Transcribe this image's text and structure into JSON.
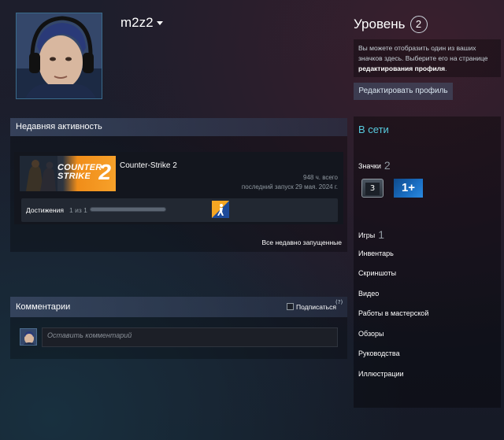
{
  "profile": {
    "username": "m2z2"
  },
  "level": {
    "title": "Уровень",
    "value": "2",
    "description_part1": "Вы можете отобразить один из ваших значков здесь. Выберите его на странице ",
    "description_link": "редактирования профиля",
    "description_end": ".",
    "edit_button": "Редактировать профиль"
  },
  "recent_activity": {
    "title": "Недавняя активность",
    "game": {
      "name": "Counter-Strike 2",
      "cover_line1": "COUNTER",
      "cover_line2": "STRIKE",
      "cover_number": "2",
      "hours": "948 ч. всего",
      "last_played": "последний запуск 29 мая. 2024 г."
    },
    "achievements": {
      "label": "Достижения",
      "count": "1 из 1",
      "progress_fraction": 1.0
    },
    "all_recent": "Все недавно запущенные"
  },
  "comments": {
    "title": "Комментарии",
    "subscribe": "Подписаться",
    "help": "(?)",
    "placeholder": "Оставить комментарий"
  },
  "sidebar": {
    "status": "В сети",
    "badges": {
      "label": "Значки",
      "count": "2",
      "badge_level": "3",
      "badge_years": "1+"
    },
    "games": {
      "label": "Игры",
      "count": "1"
    },
    "links": [
      "Инвентарь",
      "Скриншоты",
      "Видео",
      "Работы в мастерской",
      "Обзоры",
      "Руководства",
      "Иллюстрации"
    ]
  },
  "colors": {
    "online": "#57cbde",
    "accent": "#67c1f5"
  }
}
